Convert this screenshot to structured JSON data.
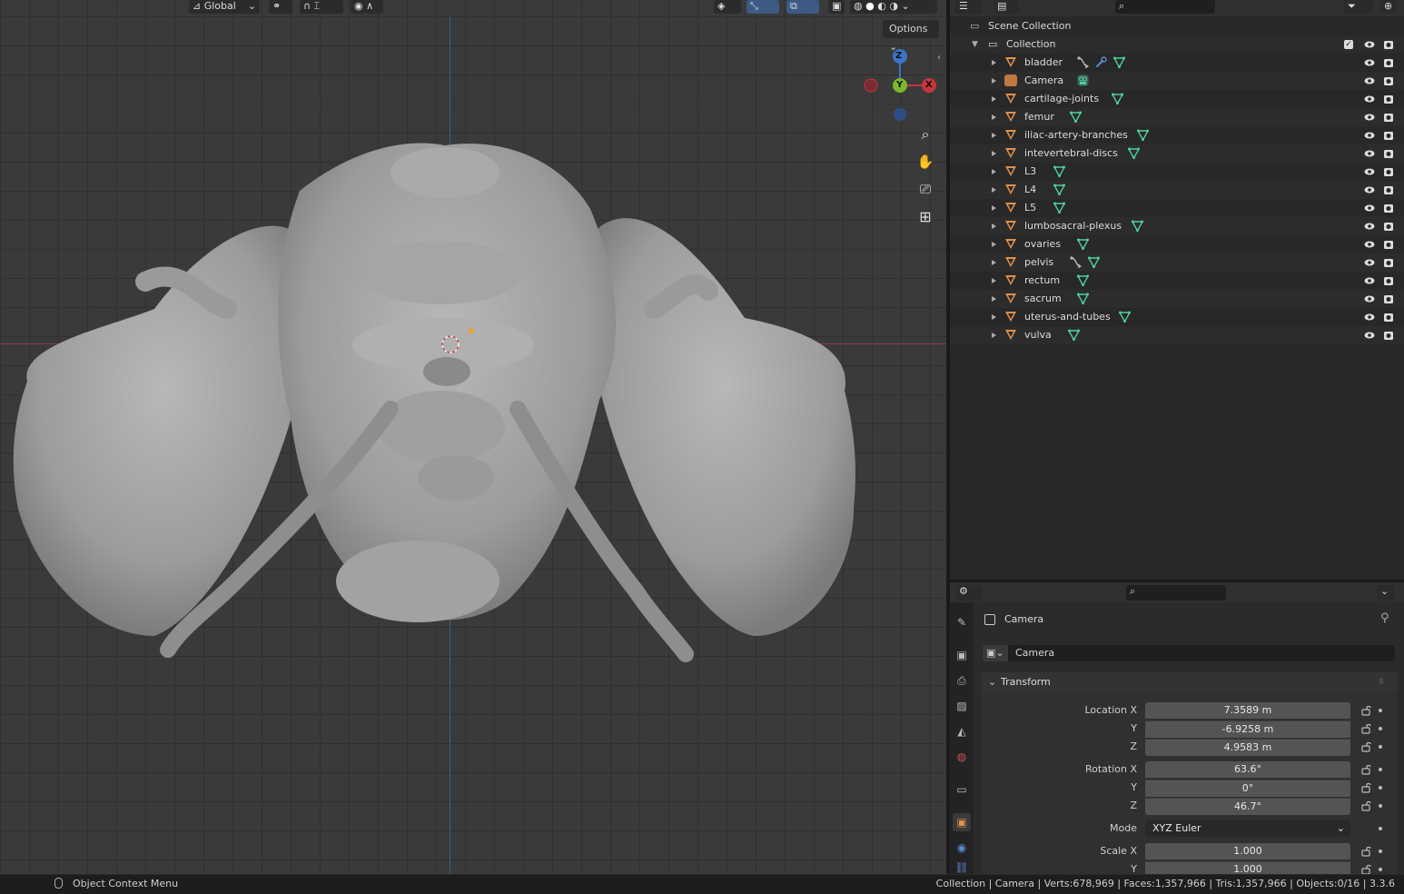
{
  "viewport": {
    "transform_orientation": "Global",
    "options_label": "Options",
    "gizmo": {
      "z": "Z",
      "y": "Y",
      "x": "X"
    }
  },
  "outliner": {
    "scene_collection": "Scene Collection",
    "collection": "Collection",
    "objects": [
      {
        "name": "bladder",
        "type": "mesh",
        "extras": [
          "constraint",
          "modifier",
          "mesh-data"
        ]
      },
      {
        "name": "Camera",
        "type": "camera",
        "extras": [
          "camera-data"
        ]
      },
      {
        "name": "cartilage-joints",
        "type": "mesh",
        "extras": [
          "mesh-data"
        ]
      },
      {
        "name": "femur",
        "type": "mesh",
        "extras": [
          "mesh-data"
        ]
      },
      {
        "name": "iliac-artery-branches",
        "type": "mesh",
        "extras": [
          "mesh-data"
        ]
      },
      {
        "name": "intevertebral-discs",
        "type": "mesh",
        "extras": [
          "mesh-data"
        ]
      },
      {
        "name": "L3",
        "type": "mesh",
        "extras": [
          "mesh-data"
        ]
      },
      {
        "name": "L4",
        "type": "mesh",
        "extras": [
          "mesh-data"
        ]
      },
      {
        "name": "L5",
        "type": "mesh",
        "extras": [
          "mesh-data"
        ]
      },
      {
        "name": "lumbosacral-plexus",
        "type": "mesh",
        "extras": [
          "mesh-data"
        ]
      },
      {
        "name": "ovaries",
        "type": "mesh",
        "extras": [
          "mesh-data"
        ]
      },
      {
        "name": "pelvis",
        "type": "mesh",
        "extras": [
          "constraint",
          "mesh-data"
        ]
      },
      {
        "name": "rectum",
        "type": "mesh",
        "extras": [
          "mesh-data"
        ]
      },
      {
        "name": "sacrum",
        "type": "mesh",
        "extras": [
          "mesh-data"
        ]
      },
      {
        "name": "uterus-and-tubes",
        "type": "mesh",
        "extras": [
          "mesh-data"
        ]
      },
      {
        "name": "vulva",
        "type": "mesh",
        "extras": [
          "mesh-data"
        ]
      }
    ]
  },
  "properties": {
    "context_name": "Camera",
    "object_name": "Camera",
    "panel_title": "Transform",
    "location": {
      "label_x": "Location X",
      "label_y": "Y",
      "label_z": "Z",
      "x": "7.3589 m",
      "y": "-6.9258 m",
      "z": "4.9583 m"
    },
    "rotation": {
      "label_x": "Rotation X",
      "label_y": "Y",
      "label_z": "Z",
      "x": "63.6°",
      "y": "0°",
      "z": "46.7°"
    },
    "mode": {
      "label": "Mode",
      "value": "XYZ Euler"
    },
    "scale": {
      "label_x": "Scale X",
      "label_y": "Y",
      "x": "1.000",
      "y": "1.000"
    }
  },
  "statusbar": {
    "left": "Object Context Menu",
    "right": "Collection | Camera | Verts:678,969 | Faces:1,357,966 | Tris:1,357,966 | Objects:0/16 | 3.3.6"
  },
  "colors": {
    "mesh": "#e0904a",
    "mesh_data": "#4fcf9a",
    "axis_x": "#c8353f",
    "axis_y": "#7ab82c",
    "axis_z": "#3c74c9"
  }
}
